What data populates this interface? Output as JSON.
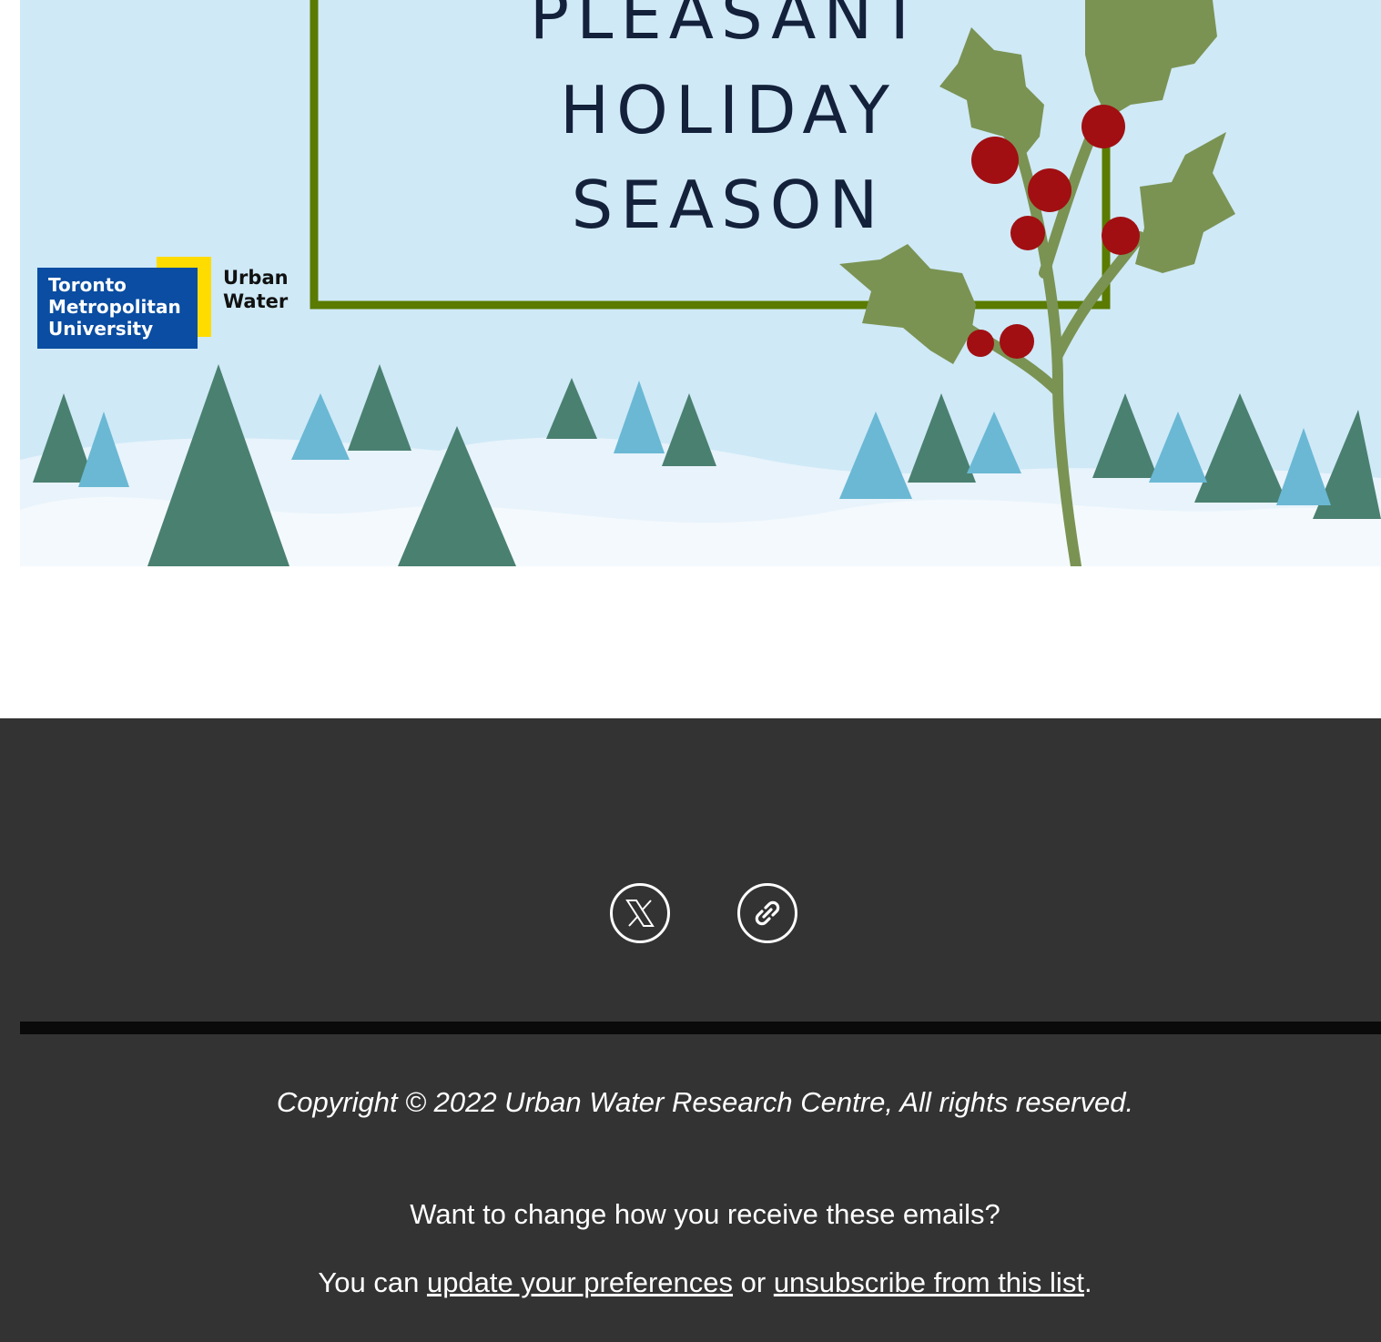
{
  "banner": {
    "greeting_lines": [
      "PLEASANT",
      "HOLIDAY",
      "SEASON"
    ],
    "logo": {
      "university_lines": [
        "Toronto",
        "Metropolitan",
        "University"
      ],
      "unit_lines": [
        "Urban",
        "Water"
      ],
      "colors": {
        "blue": "#0a4da2",
        "yellow": "#ffdc00"
      }
    },
    "colors": {
      "sky": "#cfe9f7",
      "frame": "#5a7a00",
      "holly_leaf": "#7a9353",
      "berry": "#a10f12",
      "tree_dark": "#4a8070",
      "tree_light": "#6ab8d4"
    }
  },
  "footer": {
    "background": "#333333",
    "social": [
      {
        "name": "x-icon",
        "label": "X"
      },
      {
        "name": "link-icon",
        "label": "Website"
      }
    ],
    "copyright": "Copyright © 2022 Urban Water Research Centre, All rights reserved.",
    "question": "Want to change how you receive these emails?",
    "prefs_prefix": "You can ",
    "update_link": "update your preferences",
    "prefs_middle": " or ",
    "unsubscribe_link": "unsubscribe from this list",
    "prefs_suffix": "."
  }
}
